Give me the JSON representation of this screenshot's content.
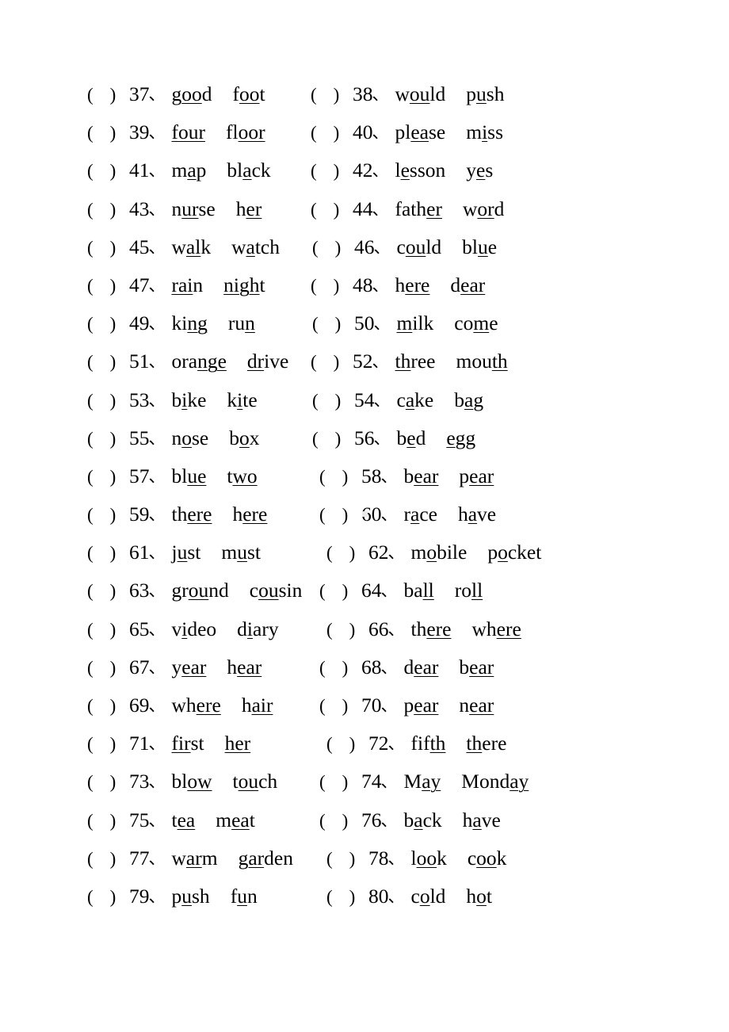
{
  "document": {
    "type": "phonics-underline-worksheet",
    "bracket": {
      "left_paren": "(",
      "right_paren": ")"
    },
    "number_separator": "、",
    "item_range": {
      "first": 37,
      "last": 80
    },
    "columns": 2
  },
  "items": [
    {
      "number": "37",
      "indent": 0,
      "column": "left",
      "words": [
        {
          "text": "good",
          "pre": "g",
          "mark": "oo",
          "post": "d"
        },
        {
          "text": "foot",
          "pre": "f",
          "mark": "oo",
          "post": "t"
        }
      ]
    },
    {
      "number": "38",
      "indent": 0,
      "column": "right",
      "words": [
        {
          "text": "would",
          "pre": "w",
          "mark": "ou",
          "post": "ld"
        },
        {
          "text": "push",
          "pre": "p",
          "mark": "u",
          "post": "sh"
        }
      ]
    },
    {
      "number": "39",
      "indent": 0,
      "column": "left",
      "words": [
        {
          "text": "four",
          "pre": "",
          "mark": "four",
          "post": ""
        },
        {
          "text": "floor",
          "pre": "fl",
          "mark": "oor",
          "post": ""
        }
      ]
    },
    {
      "number": "40",
      "indent": 0,
      "column": "right",
      "words": [
        {
          "text": "please",
          "pre": "pl",
          "mark": "ea",
          "post": "se"
        },
        {
          "text": "miss",
          "pre": "m",
          "mark": "i",
          "post": "ss"
        }
      ]
    },
    {
      "number": "41",
      "indent": 0,
      "column": "left",
      "words": [
        {
          "text": "map",
          "pre": "m",
          "mark": "a",
          "post": "p"
        },
        {
          "text": "black",
          "pre": "bl",
          "mark": "a",
          "post": "ck"
        }
      ]
    },
    {
      "number": "42",
      "indent": 0,
      "column": "right",
      "words": [
        {
          "text": "lesson",
          "pre": "l",
          "mark": "e",
          "post": "sson"
        },
        {
          "text": "yes",
          "pre": "y",
          "mark": "e",
          "post": "s"
        }
      ]
    },
    {
      "number": "43",
      "indent": 0,
      "column": "left",
      "words": [
        {
          "text": "nurse",
          "pre": "n",
          "mark": "ur",
          "post": "se"
        },
        {
          "text": "her",
          "pre": "h",
          "mark": "er",
          "post": ""
        }
      ]
    },
    {
      "number": "44",
      "indent": 0,
      "column": "right",
      "words": [
        {
          "text": "father",
          "pre": "fath",
          "mark": "er",
          "post": ""
        },
        {
          "text": "word",
          "pre": "w",
          "mark": "or",
          "post": "d"
        }
      ]
    },
    {
      "number": "45",
      "indent": 0,
      "column": "left",
      "words": [
        {
          "text": "walk",
          "pre": "w",
          "mark": "al",
          "post": "k"
        },
        {
          "text": "watch",
          "pre": "w",
          "mark": "a",
          "post": "tch"
        }
      ]
    },
    {
      "number": "46",
      "indent": 1,
      "column": "right",
      "words": [
        {
          "text": "could",
          "pre": "c",
          "mark": "ou",
          "post": "ld"
        },
        {
          "text": "blue",
          "pre": "bl",
          "mark": "u",
          "post": "e"
        }
      ]
    },
    {
      "number": "47",
      "indent": 0,
      "column": "left",
      "words": [
        {
          "text": "rain",
          "pre": "",
          "mark": "rai",
          "post": "n"
        },
        {
          "text": "night",
          "pre": "",
          "mark": "nigh",
          "post": "t"
        }
      ]
    },
    {
      "number": "48",
      "indent": 0,
      "column": "right",
      "words": [
        {
          "text": "here",
          "pre": "h",
          "mark": "ere",
          "post": ""
        },
        {
          "text": "dear",
          "pre": "d",
          "mark": "ear",
          "post": ""
        }
      ]
    },
    {
      "number": "49",
      "indent": 0,
      "column": "left",
      "words": [
        {
          "text": "king",
          "pre": "ki",
          "mark": "ng",
          "post": ""
        },
        {
          "text": "run",
          "pre": "ru",
          "mark": "n",
          "post": ""
        }
      ]
    },
    {
      "number": "50",
      "indent": 1,
      "column": "right",
      "words": [
        {
          "text": "milk",
          "pre": "",
          "mark": "m",
          "post": "ilk"
        },
        {
          "text": "come",
          "pre": "co",
          "mark": "m",
          "post": "e"
        }
      ]
    },
    {
      "number": "51",
      "indent": 0,
      "column": "left",
      "words": [
        {
          "text": "orange",
          "pre": "ora",
          "mark": "nge",
          "post": ""
        },
        {
          "text": "drive",
          "pre": "",
          "mark": "dr",
          "post": "ive"
        }
      ]
    },
    {
      "number": "52",
      "indent": 0,
      "column": "right",
      "words": [
        {
          "text": "three",
          "pre": "",
          "mark": "th",
          "post": "ree"
        },
        {
          "text": "mouth",
          "pre": "mou",
          "mark": "th",
          "post": ""
        }
      ]
    },
    {
      "number": "53",
      "indent": 0,
      "column": "left",
      "words": [
        {
          "text": "bike",
          "pre": "b",
          "mark": "i",
          "post": "ke"
        },
        {
          "text": "kite",
          "pre": "k",
          "mark": "i",
          "post": "te"
        }
      ]
    },
    {
      "number": "54",
      "indent": 1,
      "column": "right",
      "words": [
        {
          "text": "cake",
          "pre": "c",
          "mark": "a",
          "post": "ke"
        },
        {
          "text": "bag",
          "pre": "b",
          "mark": "a",
          "post": "g"
        }
      ]
    },
    {
      "number": "55",
      "indent": 0,
      "column": "left",
      "words": [
        {
          "text": "nose",
          "pre": "n",
          "mark": "o",
          "post": "se"
        },
        {
          "text": "box",
          "pre": "b",
          "mark": "o",
          "post": "x"
        }
      ]
    },
    {
      "number": "56",
      "indent": 1,
      "column": "right",
      "words": [
        {
          "text": "bed",
          "pre": "b",
          "mark": "e",
          "post": "d"
        },
        {
          "text": "egg",
          "pre": "",
          "mark": "e",
          "post": "gg"
        }
      ]
    },
    {
      "number": "57",
      "indent": 0,
      "column": "left",
      "words": [
        {
          "text": "blue",
          "pre": "bl",
          "mark": "ue",
          "post": ""
        },
        {
          "text": "two",
          "pre": "t",
          "mark": "wo",
          "post": ""
        }
      ]
    },
    {
      "number": "58",
      "indent": 2,
      "column": "right",
      "words": [
        {
          "text": "bear",
          "pre": "b",
          "mark": "ear",
          "post": ""
        },
        {
          "text": "pear",
          "pre": "p",
          "mark": "ear",
          "post": ""
        }
      ]
    },
    {
      "number": "59",
      "indent": 0,
      "column": "left",
      "words": [
        {
          "text": "there",
          "pre": "th",
          "mark": "ere",
          "post": ""
        },
        {
          "text": "here",
          "pre": "h",
          "mark": "ere",
          "post": ""
        }
      ]
    },
    {
      "number": "60",
      "indent": 2,
      "column": "right",
      "words": [
        {
          "text": "race",
          "pre": "r",
          "mark": "a",
          "post": "ce"
        },
        {
          "text": "have",
          "pre": "h",
          "mark": "a",
          "post": "ve"
        }
      ]
    },
    {
      "number": "61",
      "indent": 0,
      "column": "left",
      "words": [
        {
          "text": "just",
          "pre": "j",
          "mark": "u",
          "post": "st"
        },
        {
          "text": "must",
          "pre": "m",
          "mark": "u",
          "post": "st"
        }
      ]
    },
    {
      "number": "62",
      "indent": 3,
      "column": "right",
      "words": [
        {
          "text": "mobile",
          "pre": "m",
          "mark": "o",
          "post": "bile"
        },
        {
          "text": "pocket",
          "pre": "p",
          "mark": "o",
          "post": "cket"
        }
      ]
    },
    {
      "number": "63",
      "indent": 0,
      "column": "left",
      "words": [
        {
          "text": "ground",
          "pre": "gr",
          "mark": "ou",
          "post": "nd"
        },
        {
          "text": "cousin",
          "pre": "c",
          "mark": "ou",
          "post": "sin"
        }
      ]
    },
    {
      "number": "64",
      "indent": 2,
      "column": "right",
      "words": [
        {
          "text": "ball",
          "pre": "ba",
          "mark": "ll",
          "post": ""
        },
        {
          "text": "roll",
          "pre": "ro",
          "mark": "ll",
          "post": ""
        }
      ]
    },
    {
      "number": "65",
      "indent": 0,
      "column": "left",
      "words": [
        {
          "text": "video",
          "pre": "v",
          "mark": "i",
          "post": "deo"
        },
        {
          "text": "diary",
          "pre": "d",
          "mark": "i",
          "post": "ary"
        }
      ]
    },
    {
      "number": "66",
      "indent": 3,
      "column": "right",
      "words": [
        {
          "text": "there",
          "pre": "th",
          "mark": "ere",
          "post": ""
        },
        {
          "text": "where",
          "pre": "wh",
          "mark": "ere",
          "post": ""
        }
      ]
    },
    {
      "number": "67",
      "indent": 0,
      "column": "left",
      "words": [
        {
          "text": "year",
          "pre": "y",
          "mark": "ear",
          "post": ""
        },
        {
          "text": "hear",
          "pre": "h",
          "mark": "ear",
          "post": ""
        }
      ]
    },
    {
      "number": "68",
      "indent": 2,
      "column": "right",
      "words": [
        {
          "text": "dear",
          "pre": "d",
          "mark": "ear",
          "post": ""
        },
        {
          "text": "bear",
          "pre": "b",
          "mark": "ear",
          "post": ""
        }
      ]
    },
    {
      "number": "69",
      "indent": 0,
      "column": "left",
      "words": [
        {
          "text": "where",
          "pre": "wh",
          "mark": "ere",
          "post": ""
        },
        {
          "text": "hair",
          "pre": "h",
          "mark": "air",
          "post": ""
        }
      ]
    },
    {
      "number": "70",
      "indent": 2,
      "column": "right",
      "words": [
        {
          "text": "pear",
          "pre": "p",
          "mark": "ear",
          "post": ""
        },
        {
          "text": "near",
          "pre": "n",
          "mark": "ear",
          "post": ""
        }
      ]
    },
    {
      "number": "71",
      "indent": 0,
      "column": "left",
      "words": [
        {
          "text": "first",
          "pre": "",
          "mark": "fir",
          "post": "st"
        },
        {
          "text": "her",
          "pre": "",
          "mark": "her",
          "post": ""
        }
      ]
    },
    {
      "number": "72",
      "indent": 3,
      "column": "right",
      "words": [
        {
          "text": "fifth",
          "pre": "fif",
          "mark": "th",
          "post": ""
        },
        {
          "text": "there",
          "pre": "",
          "mark": "th",
          "post": "ere"
        }
      ]
    },
    {
      "number": "73",
      "indent": 0,
      "column": "left",
      "words": [
        {
          "text": "blow",
          "pre": "bl",
          "mark": "ow",
          "post": ""
        },
        {
          "text": "touch",
          "pre": "t",
          "mark": "ou",
          "post": "ch"
        }
      ]
    },
    {
      "number": "74",
      "indent": 2,
      "column": "right",
      "words": [
        {
          "text": "May",
          "pre": "M",
          "mark": "ay",
          "post": ""
        },
        {
          "text": "Monday",
          "pre": "Mond",
          "mark": "ay",
          "post": ""
        }
      ]
    },
    {
      "number": "75",
      "indent": 0,
      "column": "left",
      "words": [
        {
          "text": "tea",
          "pre": "t",
          "mark": "ea",
          "post": ""
        },
        {
          "text": "meat",
          "pre": "m",
          "mark": "ea",
          "post": "t"
        }
      ]
    },
    {
      "number": "76",
      "indent": 2,
      "column": "right",
      "words": [
        {
          "text": "back",
          "pre": "b",
          "mark": "a",
          "post": "ck"
        },
        {
          "text": "have",
          "pre": "h",
          "mark": "a",
          "post": "ve"
        }
      ]
    },
    {
      "number": "77",
      "indent": 0,
      "column": "left",
      "words": [
        {
          "text": "warm",
          "pre": "w",
          "mark": "ar",
          "post": "m"
        },
        {
          "text": "garden",
          "pre": "",
          "mark": "gar",
          "post": "den"
        }
      ]
    },
    {
      "number": "78",
      "indent": 3,
      "column": "right",
      "words": [
        {
          "text": "look",
          "pre": "l",
          "mark": "oo",
          "post": "k"
        },
        {
          "text": "cook",
          "pre": "c",
          "mark": "oo",
          "post": "k"
        }
      ]
    },
    {
      "number": "79",
      "indent": 0,
      "column": "left",
      "words": [
        {
          "text": "push",
          "pre": "p",
          "mark": "u",
          "post": "sh"
        },
        {
          "text": "fun",
          "pre": "f",
          "mark": "u",
          "post": "n"
        }
      ]
    },
    {
      "number": "80",
      "indent": 3,
      "column": "right",
      "words": [
        {
          "text": "cold",
          "pre": "c",
          "mark": "o",
          "post": "ld"
        },
        {
          "text": "hot",
          "pre": "h",
          "mark": "o",
          "post": "t"
        }
      ]
    }
  ]
}
